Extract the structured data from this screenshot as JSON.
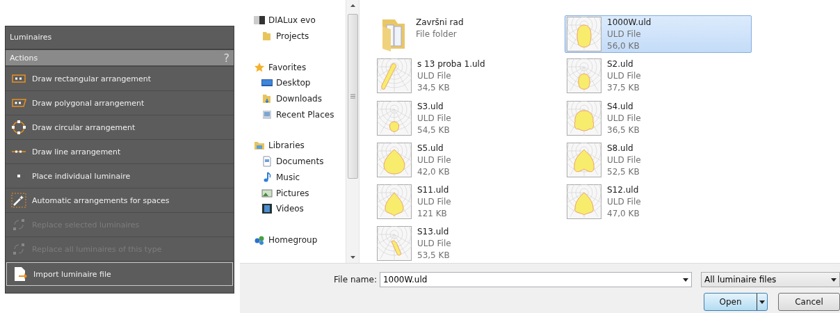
{
  "luminaires_panel": {
    "title": "Luminaires",
    "section": "Actions",
    "help": "?",
    "actions": [
      {
        "label": "Draw rectangular arrangement",
        "disabled": false,
        "selected": false
      },
      {
        "label": "Draw polygonal arrangement",
        "disabled": false,
        "selected": false
      },
      {
        "label": "Draw circular arrangement",
        "disabled": false,
        "selected": false
      },
      {
        "label": "Draw line arrangement",
        "disabled": false,
        "selected": false
      },
      {
        "label": "Place individual luminaire",
        "disabled": false,
        "selected": false
      },
      {
        "label": "Automatic arrangements for spaces",
        "disabled": false,
        "selected": false
      },
      {
        "label": "Replace selected luminaires",
        "disabled": true,
        "selected": false
      },
      {
        "label": "Replace all luminaires of this type",
        "disabled": true,
        "selected": false
      },
      {
        "label": "Import luminaire file",
        "disabled": false,
        "selected": true
      }
    ]
  },
  "navigation": [
    {
      "label": "DIALux evo",
      "children": [
        {
          "label": "Projects"
        }
      ]
    },
    {
      "label": "Favorites",
      "children": [
        {
          "label": "Desktop"
        },
        {
          "label": "Downloads"
        },
        {
          "label": "Recent Places"
        }
      ]
    },
    {
      "label": "Libraries",
      "children": [
        {
          "label": "Documents"
        },
        {
          "label": "Music"
        },
        {
          "label": "Pictures"
        },
        {
          "label": "Videos"
        }
      ]
    },
    {
      "label": "Homegroup"
    }
  ],
  "files": [
    {
      "kind": "folder",
      "name": "Završni rad",
      "type": "File folder",
      "selected": false
    },
    {
      "kind": "uld",
      "name": "1000W.uld",
      "type": "ULD File",
      "size": "56,0 KB",
      "selected": true
    },
    {
      "kind": "uld",
      "name": "s 13 proba 1.uld",
      "type": "ULD File",
      "size": "34,5 KB",
      "selected": false
    },
    {
      "kind": "uld",
      "name": "S2.uld",
      "type": "ULD File",
      "size": "37,5 KB",
      "selected": false
    },
    {
      "kind": "uld",
      "name": "S3.uld",
      "type": "ULD File",
      "size": "54,5 KB",
      "selected": false
    },
    {
      "kind": "uld",
      "name": "S4.uld",
      "type": "ULD File",
      "size": "36,5 KB",
      "selected": false
    },
    {
      "kind": "uld",
      "name": "S5.uld",
      "type": "ULD File",
      "size": "42,0 KB",
      "selected": false
    },
    {
      "kind": "uld",
      "name": "S8.uld",
      "type": "ULD File",
      "size": "52,5 KB",
      "selected": false
    },
    {
      "kind": "uld",
      "name": "S11.uld",
      "type": "ULD File",
      "size": "121 KB",
      "selected": false
    },
    {
      "kind": "uld",
      "name": "S12.uld",
      "type": "ULD File",
      "size": "47,0 KB",
      "selected": false
    },
    {
      "kind": "uld",
      "name": "S13.uld",
      "type": "ULD File",
      "size": "53,5 KB",
      "selected": false
    }
  ],
  "footer": {
    "file_name_label": "File name:",
    "file_name": "1000W.uld",
    "filter": "All luminaire files",
    "buttons": [
      "Open",
      "Cancel"
    ]
  }
}
